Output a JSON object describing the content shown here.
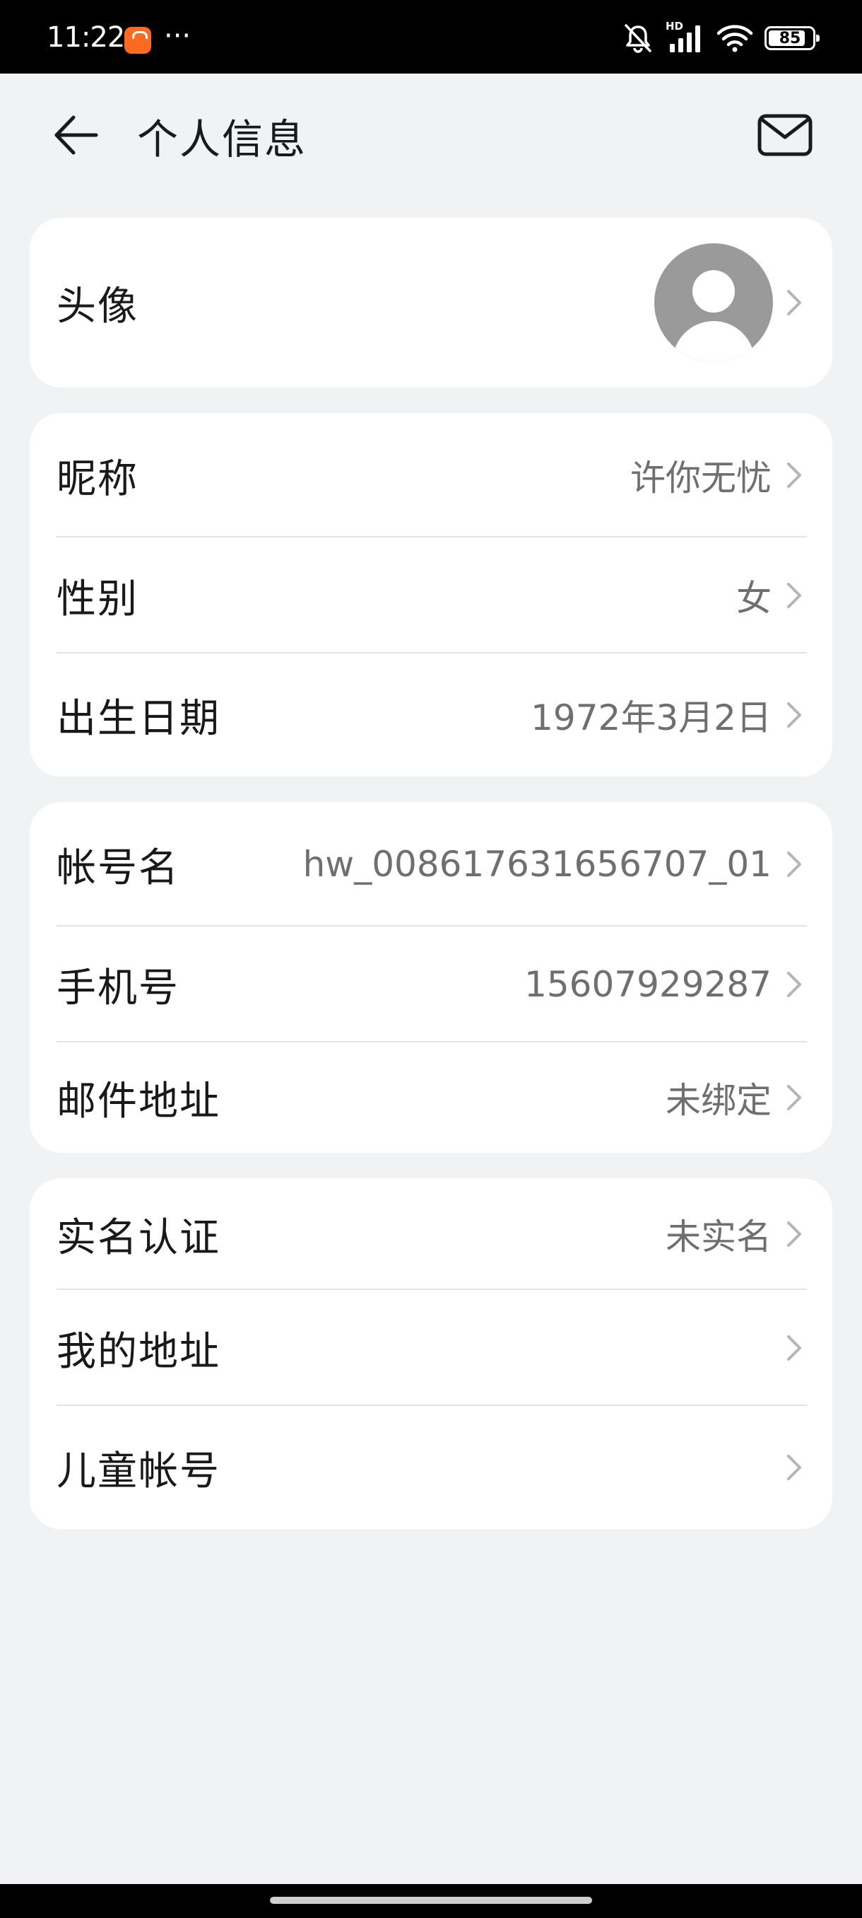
{
  "status_bar": {
    "time": "11:22",
    "more": "···",
    "battery": "85",
    "battery_level": 0.85,
    "hd_label": "HD"
  },
  "header": {
    "title": "个人信息"
  },
  "sections": {
    "avatar": {
      "label": "头像"
    },
    "profile": [
      {
        "label": "昵称",
        "value": "许你无忧"
      },
      {
        "label": "性别",
        "value": "女"
      },
      {
        "label": "出生日期",
        "value": "1972年3月2日"
      }
    ],
    "account": [
      {
        "label": "帐号名",
        "value": "hw_008617631656707_01"
      },
      {
        "label": "手机号",
        "value": "15607929287"
      },
      {
        "label": "邮件地址",
        "value": "未绑定"
      }
    ],
    "other": [
      {
        "label": "实名认证",
        "value": "未实名"
      },
      {
        "label": "我的地址",
        "value": ""
      },
      {
        "label": "儿童帐号",
        "value": ""
      }
    ]
  },
  "colors": {
    "background": "#f1f2f4",
    "card": "#ffffff",
    "value_text": "#6f6f6f",
    "status_bar": "#000000"
  }
}
